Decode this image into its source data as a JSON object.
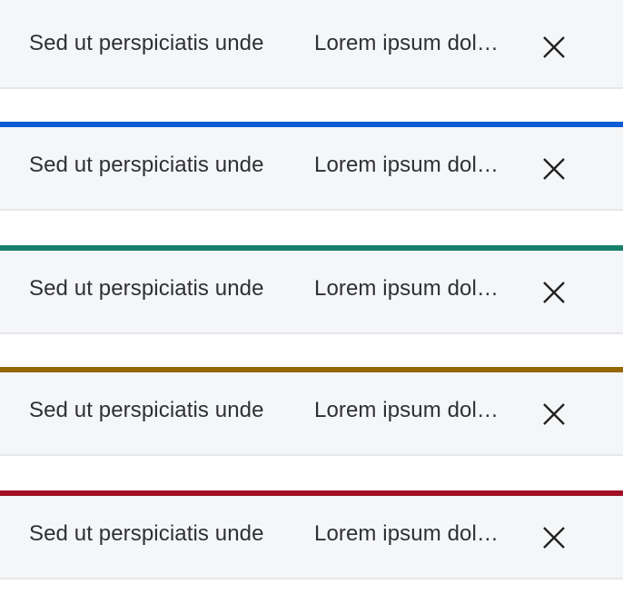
{
  "notifications": [
    {
      "kind": "neutral",
      "accent_color": "",
      "title": "Sed ut perspiciatis unde",
      "subtitle": "Lorem ipsum dolor sit amet",
      "close_icon": "close-icon"
    },
    {
      "kind": "info",
      "accent_color": "#0b5cd5",
      "title": "Sed ut perspiciatis unde",
      "subtitle": "Lorem ipsum dolor sit amet",
      "close_icon": "close-icon"
    },
    {
      "kind": "success",
      "accent_color": "#16806a",
      "title": "Sed ut perspiciatis unde",
      "subtitle": "Lorem ipsum dolor sit amet",
      "close_icon": "close-icon"
    },
    {
      "kind": "warning",
      "accent_color": "#946700",
      "title": "Sed ut perspiciatis unde",
      "subtitle": "Lorem ipsum dolor sit amet",
      "close_icon": "close-icon"
    },
    {
      "kind": "error",
      "accent_color": "#a11126",
      "title": "Sed ut perspiciatis unde",
      "subtitle": "Lorem ipsum dolor sit amet",
      "close_icon": "close-icon"
    }
  ],
  "colors": {
    "background": "#f5f6f8",
    "text": "#2f3033",
    "divider": "#e6e7ea"
  }
}
